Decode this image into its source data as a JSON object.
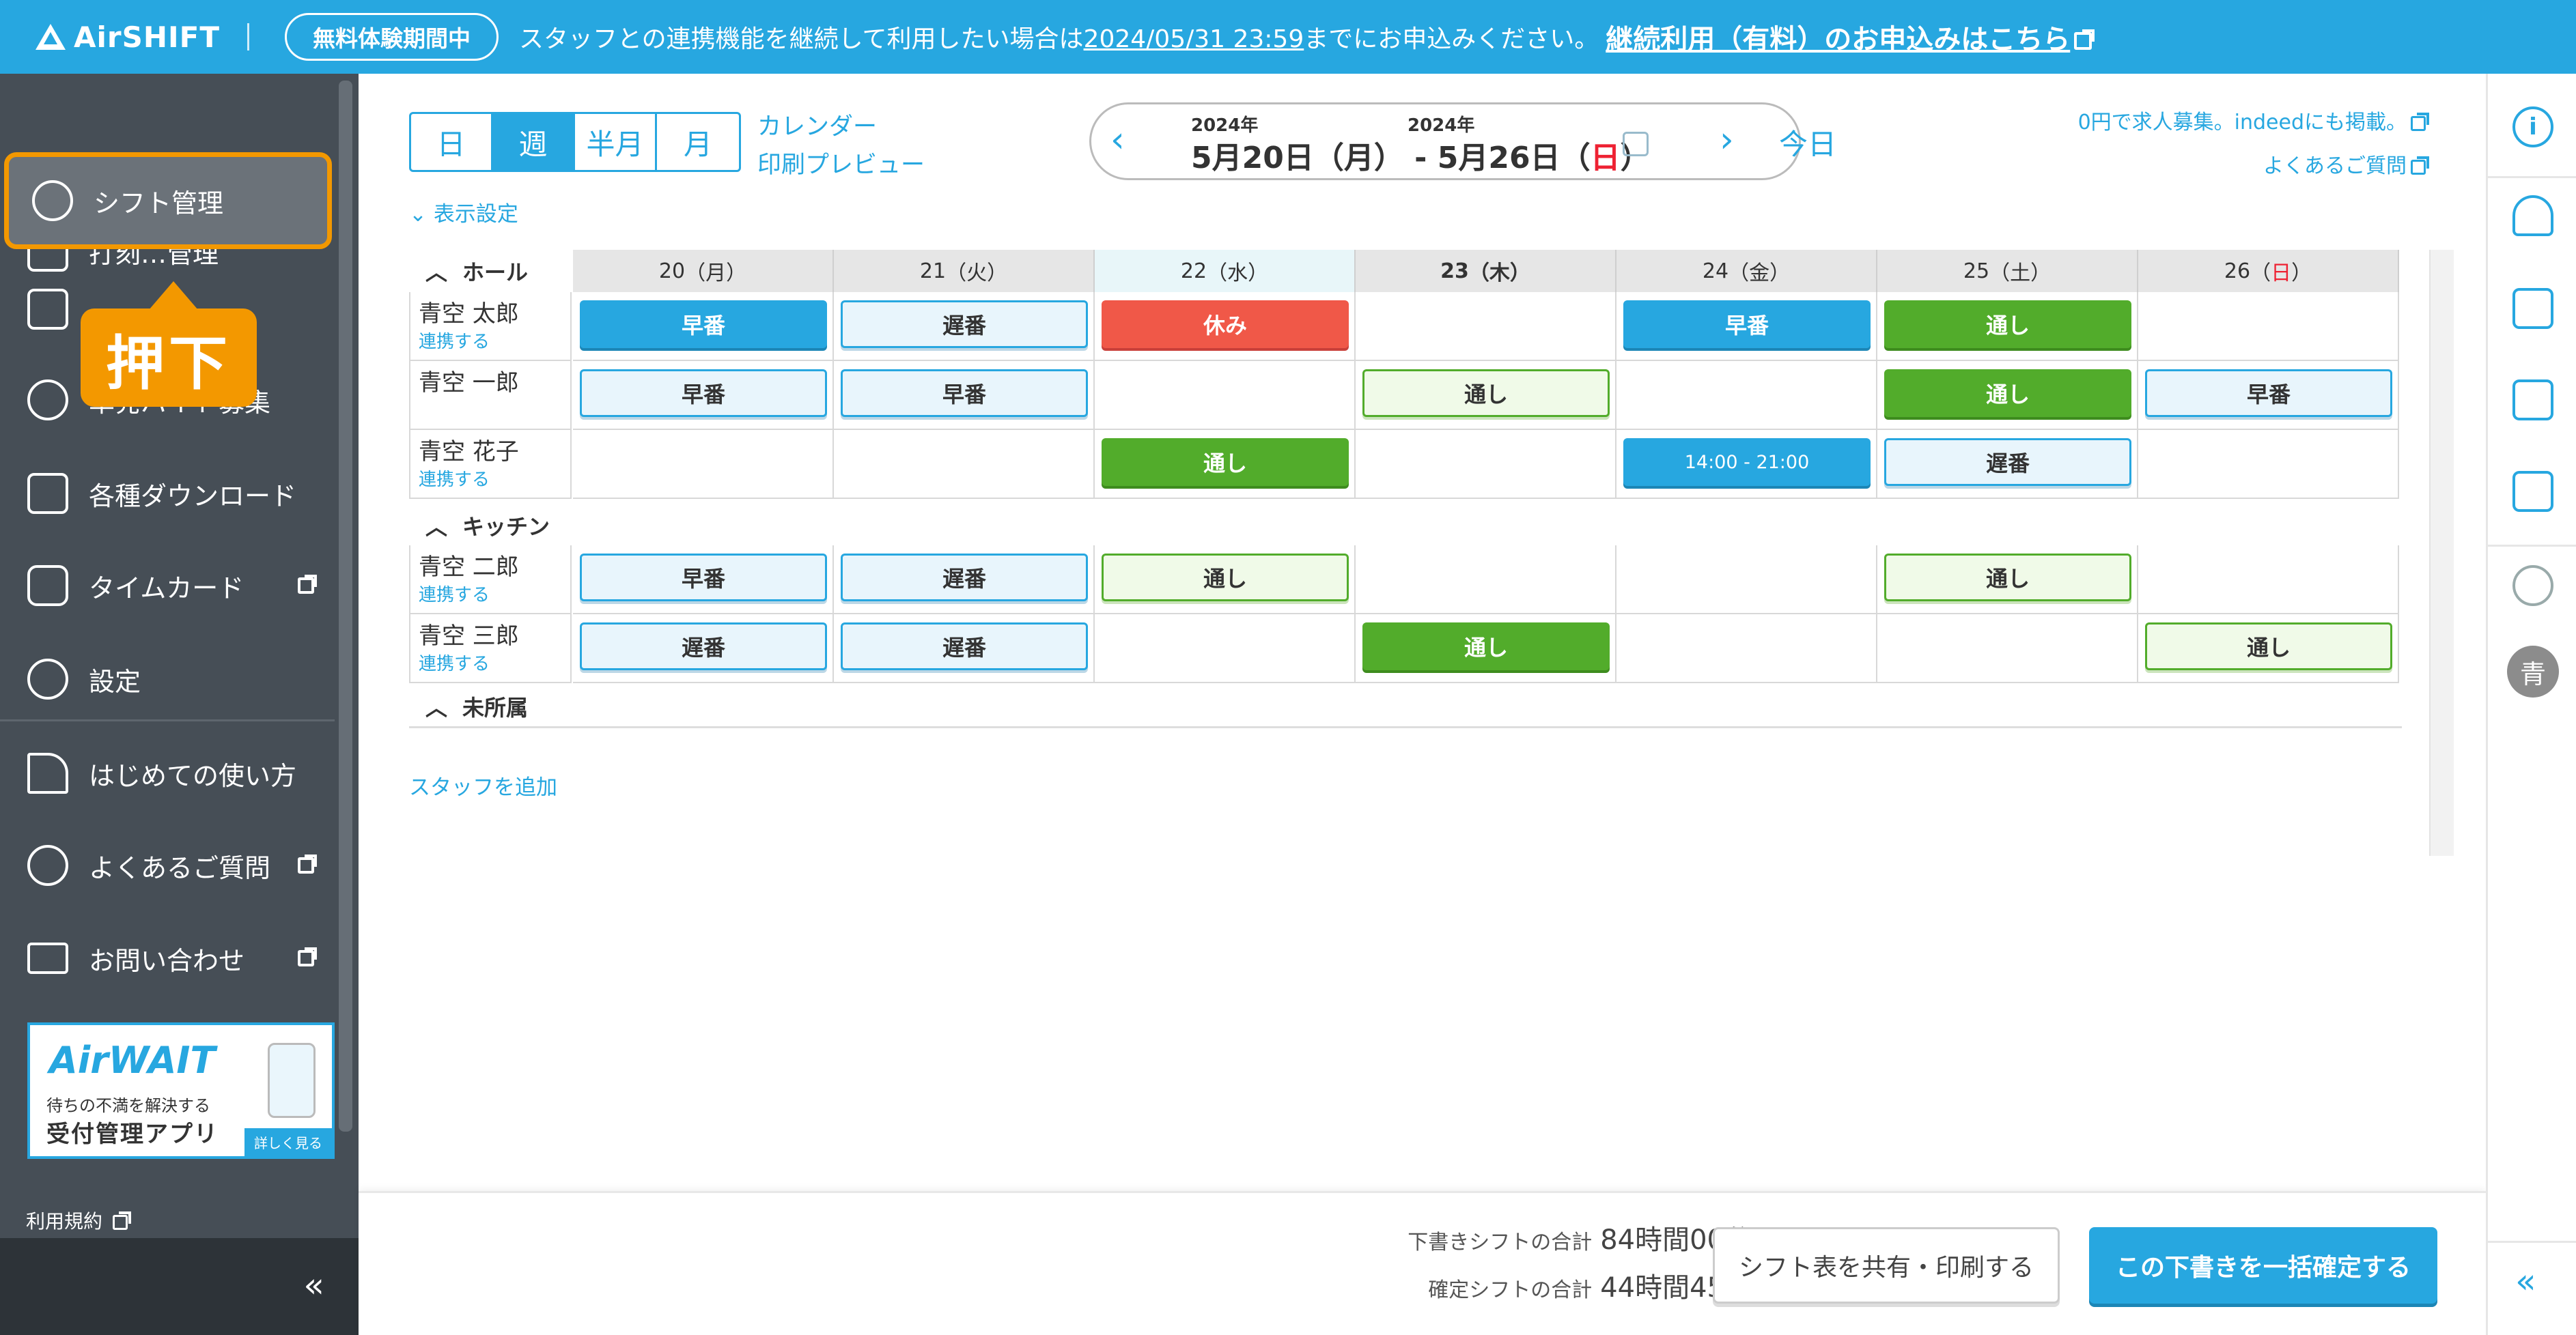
{
  "banner": {
    "logo": "AirSHIFT",
    "trial": "無料体験期間中",
    "message_pre": "スタッフとの連携機能を継続して利用したい場合は",
    "message_date": "2024/05/31 23:59",
    "message_post": "までにお申込みください。",
    "link": "継続利用（有料）のお申込みはこちら"
  },
  "sidebar": {
    "active": "シフト管理",
    "items": [
      {
        "label": "打刻…管理"
      },
      {
        "label": ""
      },
      {
        "label": "単発バイト募集"
      },
      {
        "label": "各種ダウンロード"
      },
      {
        "label": "タイムカード"
      },
      {
        "label": "設定"
      },
      {
        "label": "はじめての使い方"
      },
      {
        "label": "よくあるご質問"
      },
      {
        "label": "お問い合わせ"
      }
    ],
    "callout": "押下",
    "promo": {
      "brand": "AirWAIT",
      "line1": "待ちの不満を解決する",
      "line2": "受付管理アプリ",
      "more": "詳しく見る"
    },
    "terms": "利用規約",
    "collapse": "«"
  },
  "toolbar": {
    "views": [
      "日",
      "週",
      "半月",
      "月"
    ],
    "active_view": "週",
    "calendar_link": "カレンダー",
    "print_link": "印刷プレビュー",
    "year_from": "2024年",
    "year_to": "2024年",
    "range_pre": "5月20日（月） - 5月26日（",
    "range_sun": "日",
    "range_post": "）",
    "prev": "‹",
    "next": "›",
    "today": "今日",
    "job_link": "0円で求人募集。indeedにも掲載。",
    "faq_link": "よくあるご質問",
    "display_settings": "表示設定"
  },
  "table": {
    "group_hall": "ホール",
    "group_kitchen": "キッチン",
    "group_unassigned": "未所属",
    "days": [
      {
        "num": "20",
        "pre": "（",
        "dow": "月",
        "post": "）"
      },
      {
        "num": "21",
        "pre": "（",
        "dow": "火",
        "post": "）"
      },
      {
        "num": "22",
        "pre": "（",
        "dow": "水",
        "post": "）"
      },
      {
        "num": "23",
        "pre": "（",
        "dow": "木",
        "post": "）"
      },
      {
        "num": "24",
        "pre": "（",
        "dow": "金",
        "post": "）"
      },
      {
        "num": "25",
        "pre": "（",
        "dow": "土",
        "post": "）"
      },
      {
        "num": "26",
        "pre": "（",
        "dow": "日",
        "post": "）"
      }
    ],
    "hall": [
      {
        "name": "青空 太郎",
        "link": "連携する",
        "shifts": [
          "早番",
          "遅番",
          "休み",
          "",
          "早番",
          "通し",
          ""
        ]
      },
      {
        "name": "青空 一郎",
        "link": "",
        "shifts": [
          "早番",
          "早番",
          "",
          "通し",
          "",
          "通し",
          "早番"
        ]
      },
      {
        "name": "青空 花子",
        "link": "連携する",
        "shifts": [
          "",
          "",
          "通し",
          "",
          "14:00 - 21:00",
          "遅番",
          ""
        ]
      }
    ],
    "kitchen": [
      {
        "name": "青空 二郎",
        "link": "連携する",
        "shifts": [
          "早番",
          "遅番",
          "通し",
          "",
          "",
          "通し",
          ""
        ]
      },
      {
        "name": "青空 三郎",
        "link": "連携する",
        "shifts": [
          "遅番",
          "遅番",
          "",
          "通し",
          "",
          "",
          "通し"
        ]
      }
    ],
    "add_staff": "スタッフを追加"
  },
  "footer": {
    "draft_label": "下書きシフトの合計",
    "draft_value": "84時間00分",
    "confirmed_label": "確定シフトの合計",
    "confirmed_value": "44時間45分",
    "share_button": "シフト表を共有・印刷する",
    "confirm_button": "この下書きを一括確定する"
  },
  "rail": {
    "info_icon": "i",
    "avatar": "青",
    "collapse": "«"
  },
  "colors": {
    "accent": "#27a7e0",
    "highlight": "#f39800",
    "off": "#f05848",
    "full": "#52ac2b"
  }
}
